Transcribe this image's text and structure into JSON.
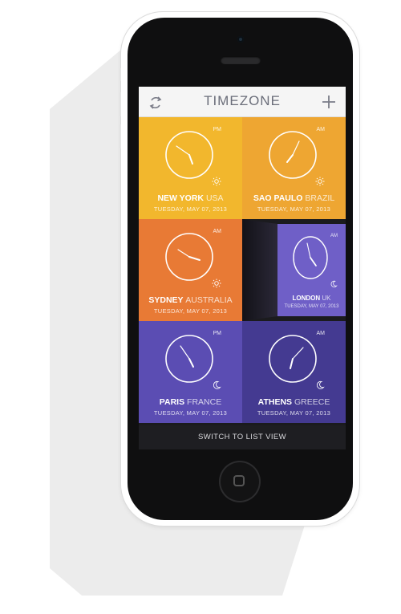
{
  "header": {
    "title_part1": "TIME",
    "title_part2": "ZONE",
    "refresh_icon": "refresh-icon",
    "add_icon": "plus-icon"
  },
  "clocks": [
    {
      "city": "NEW YORK",
      "country": "USA",
      "date": "TUESDAY, MAY 07, 2013",
      "ampm": "PM",
      "period_icon": "sun-icon",
      "color": "#f2b72d"
    },
    {
      "city": "SAO PAULO",
      "country": "BRAZIL",
      "date": "TUESDAY, MAY 07, 2013",
      "ampm": "AM",
      "period_icon": "sun-icon",
      "color": "#eea632"
    },
    {
      "city": "SYDNEY",
      "country": "AUSTRALIA",
      "date": "TUESDAY, MAY 07, 2013",
      "ampm": "AM",
      "period_icon": "sun-icon",
      "color": "#e87a35"
    },
    {
      "city": "LONDON",
      "country": "UK",
      "date": "TUESDAY, MAY 07, 2013",
      "ampm": "AM",
      "period_icon": "moon-icon",
      "color": "#6f5fc7"
    },
    {
      "city": "PARIS",
      "country": "FRANCE",
      "date": "TUESDAY, MAY 07, 2013",
      "ampm": "PM",
      "period_icon": "moon-icon",
      "color": "#5b4db3"
    },
    {
      "city": "ATHENS",
      "country": "GREECE",
      "date": "TUESDAY, MAY 07, 2013",
      "ampm": "AM",
      "period_icon": "moon-icon",
      "color": "#443a91"
    }
  ],
  "footer": {
    "switch_label": "SWITCH TO LIST VIEW"
  }
}
